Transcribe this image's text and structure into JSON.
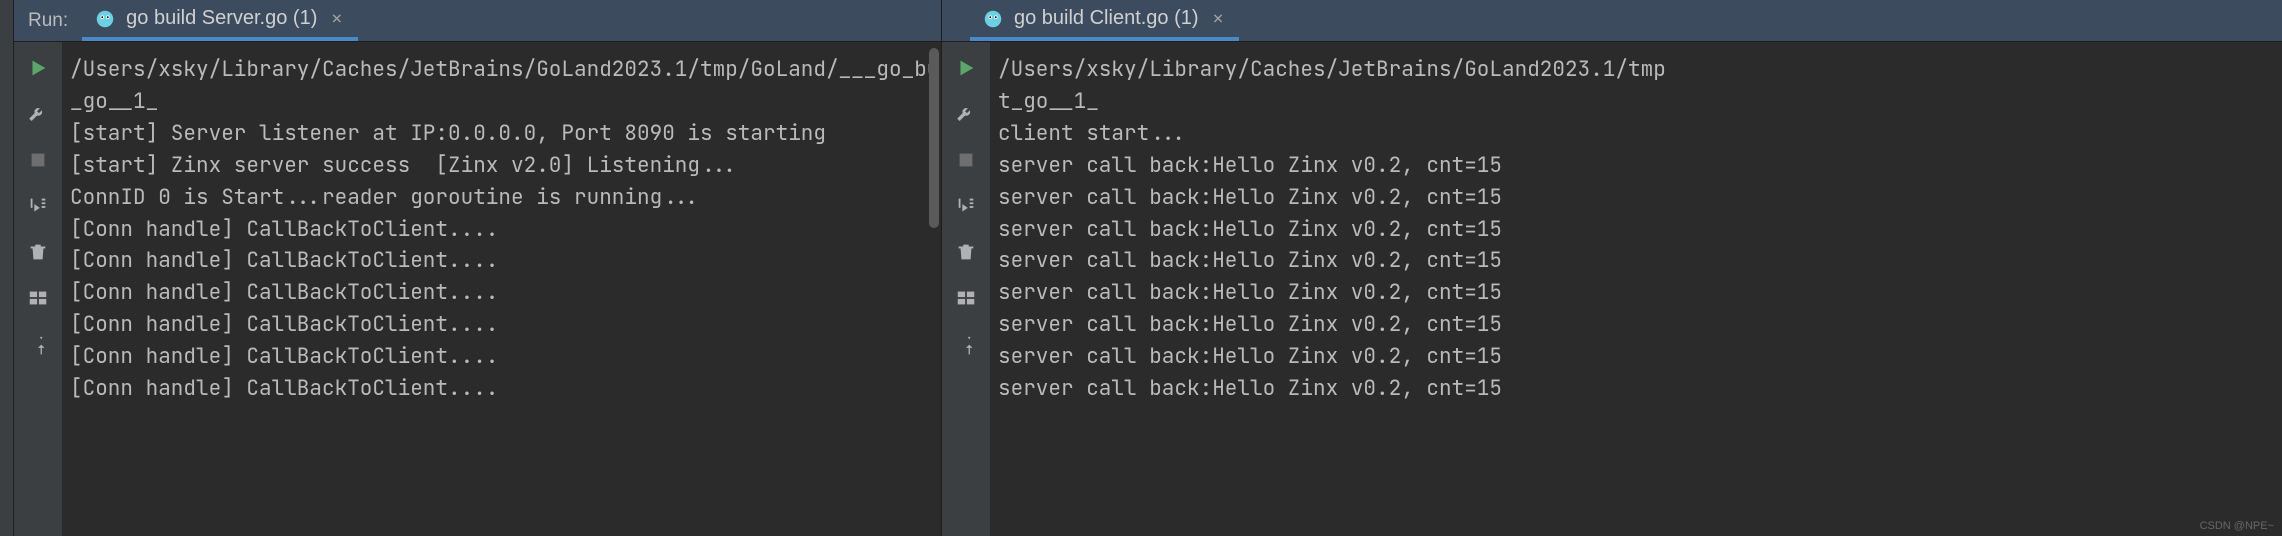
{
  "run_label": "Run:",
  "left_panel": {
    "tab": {
      "label": "go build Server.go (1)",
      "icon": "gopher"
    },
    "toolbar": [
      "play",
      "wrench",
      "stop",
      "scroll-end",
      "trash",
      "layout",
      "pin"
    ],
    "console": [
      "/Users/xsky/Library/Caches/JetBrains/GoLand2023.1/tmp/GoLand/___go_build_Server",
      "_go__1_",
      "[start] Server listener at IP:0.0.0.0, Port 8090 is starting",
      "[start] Zinx server success  [Zinx v2.0] Listening...",
      "ConnID 0 is Start...reader goroutine is running...",
      "[Conn handle] CallBackToClient....",
      "[Conn handle] CallBackToClient....",
      "[Conn handle] CallBackToClient....",
      "[Conn handle] CallBackToClient....",
      "[Conn handle] CallBackToClient....",
      "[Conn handle] CallBackToClient...."
    ]
  },
  "right_panel": {
    "tab": {
      "label": "go build Client.go (1)",
      "icon": "gopher"
    },
    "toolbar": [
      "play",
      "wrench",
      "stop",
      "scroll-end",
      "trash",
      "layout",
      "pin"
    ],
    "console": [
      "/Users/xsky/Library/Caches/JetBrains/GoLand2023.1/tmp",
      "t_go__1_",
      "client start...",
      "server call back:Hello Zinx v0.2, cnt=15",
      "server call back:Hello Zinx v0.2, cnt=15",
      "server call back:Hello Zinx v0.2, cnt=15",
      "server call back:Hello Zinx v0.2, cnt=15",
      "server call back:Hello Zinx v0.2, cnt=15",
      "server call back:Hello Zinx v0.2, cnt=15",
      "server call back:Hello Zinx v0.2, cnt=15",
      "server call back:Hello Zinx v0.2, cnt=15"
    ]
  },
  "watermark": "CSDN @NPE~"
}
